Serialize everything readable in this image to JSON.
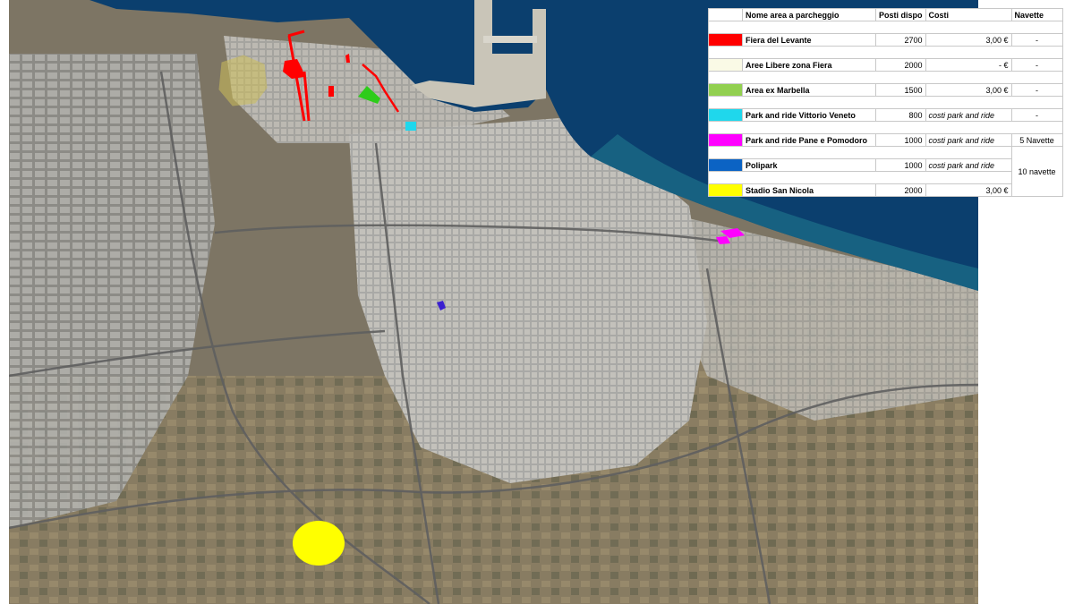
{
  "legend": {
    "headers": {
      "name": "Nome area a parcheggio",
      "posti": "Posti dispo",
      "costi": "Costi",
      "navette": "Navette"
    },
    "rows": [
      {
        "name": "Fiera del Levante",
        "posti": "2700",
        "costi": "3,00 €",
        "navette": "-",
        "color": "#ff0000"
      },
      {
        "name": "Aree Libere zona Fiera",
        "posti": "2000",
        "costi": "-    €",
        "navette": "-",
        "color": "#fafae6"
      },
      {
        "name": "Area ex Marbella",
        "posti": "1500",
        "costi": "3,00 €",
        "navette": "-",
        "color": "#92d050"
      },
      {
        "name": "Park and ride Vittorio Veneto",
        "posti": "800",
        "costi": "costi park and ride",
        "navette": "-",
        "color": "#1fd7ec"
      },
      {
        "name": "Park and ride Pane e Pomodoro",
        "posti": "1000",
        "costi": "costi park and ride",
        "navette": "5 Navette",
        "color": "#ff00ff"
      },
      {
        "name": "Polipark",
        "posti": "1000",
        "costi": "costi park and ride",
        "navette": "10 navette",
        "color": "#0b63c4"
      },
      {
        "name": "Stadio San Nicola",
        "posti": "2000",
        "costi": "3,00 €",
        "navette": "",
        "color": "#ffff00"
      }
    ]
  },
  "map": {
    "areas": [
      {
        "name": "Fiera del Levante",
        "color": "#ff0000"
      },
      {
        "name": "Aree Libere zona Fiera",
        "color": "#cdbf5a"
      },
      {
        "name": "Area ex Marbella",
        "color": "#2ecc1a"
      },
      {
        "name": "Park and ride Vittorio Veneto",
        "color": "#1fd7ec"
      },
      {
        "name": "Park and ride Pane e Pomodoro",
        "color": "#ff00ff"
      },
      {
        "name": "Polipark",
        "color": "#3a1fd0"
      },
      {
        "name": "Stadio San Nicola",
        "color": "#ffff00"
      }
    ],
    "sea_color": "#0b3f6e",
    "land_color": "#7d7a6c",
    "city_color": "#a8a8a8"
  }
}
